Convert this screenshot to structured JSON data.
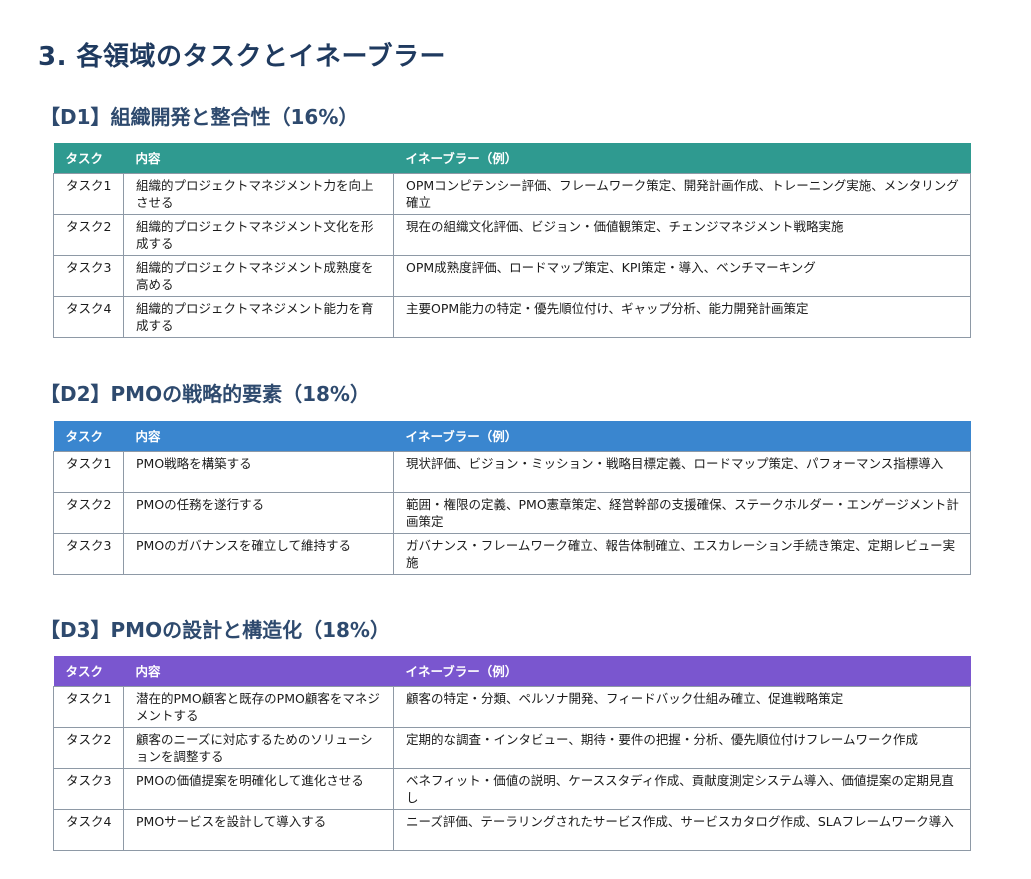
{
  "page": {
    "title": "3. 各領域のタスクとイネーブラー"
  },
  "sections": [
    {
      "heading": "【D1】組織開発と整合性（16%）",
      "header_color": "#2f9a90",
      "columns": [
        "タスク",
        "内容",
        "イネーブラー（例）"
      ],
      "rows": [
        {
          "task": "タスク1",
          "content": "組織的プロジェクトマネジメント力を向上させる",
          "enablers": "OPMコンピテンシー評価、フレームワーク策定、開発計画作成、トレーニング実施、メンタリング確立"
        },
        {
          "task": "タスク2",
          "content": "組織的プロジェクトマネジメント文化を形成する",
          "enablers": "現在の組織文化評価、ビジョン・価値観策定、チェンジマネジメント戦略実施"
        },
        {
          "task": "タスク3",
          "content": "組織的プロジェクトマネジメント成熟度を高める",
          "enablers": "OPM成熟度評価、ロードマップ策定、KPI策定・導入、ベンチマーキング"
        },
        {
          "task": "タスク4",
          "content": "組織的プロジェクトマネジメント能力を育成する",
          "enablers": "主要OPM能力の特定・優先順位付け、ギャップ分析、能力開発計画策定"
        }
      ]
    },
    {
      "heading": "【D2】PMOの戦略的要素（18%）",
      "header_color": "#3a86cf",
      "columns": [
        "タスク",
        "内容",
        "イネーブラー（例）"
      ],
      "rows": [
        {
          "task": "タスク1",
          "content": "PMO戦略を構築する",
          "enablers": "現状評価、ビジョン・ミッション・戦略目標定義、ロードマップ策定、パフォーマンス指標導入"
        },
        {
          "task": "タスク2",
          "content": "PMOの任務を遂行する",
          "enablers": "範囲・権限の定義、PMO憲章策定、経営幹部の支援確保、ステークホルダー・エンゲージメント計画策定"
        },
        {
          "task": "タスク3",
          "content": "PMOのガバナンスを確立して維持する",
          "enablers": "ガバナンス・フレームワーク確立、報告体制確立、エスカレーション手続き策定、定期レビュー実施"
        }
      ]
    },
    {
      "heading": "【D3】PMOの設計と構造化（18%）",
      "header_color": "#7a56cf",
      "columns": [
        "タスク",
        "内容",
        "イネーブラー（例）"
      ],
      "rows": [
        {
          "task": "タスク1",
          "content": "潜在的PMO顧客と既存のPMO顧客をマネジメントする",
          "enablers": "顧客の特定・分類、ペルソナ開発、フィードバック仕組み確立、促進戦略策定"
        },
        {
          "task": "タスク2",
          "content": "顧客のニーズに対応するためのソリューションを調整する",
          "enablers": "定期的な調査・インタビュー、期待・要件の把握・分析、優先順位付けフレームワーク作成"
        },
        {
          "task": "タスク3",
          "content": "PMOの価値提案を明確化して進化させる",
          "enablers": "ベネフィット・価値の説明、ケーススタディ作成、貢献度測定システム導入、価値提案の定期見直し"
        },
        {
          "task": "タスク4",
          "content": "PMOサービスを設計して導入する",
          "enablers": "ニーズ評価、テーラリングされたサービス作成、サービスカタログ作成、SLAフレームワーク導入"
        }
      ]
    }
  ]
}
